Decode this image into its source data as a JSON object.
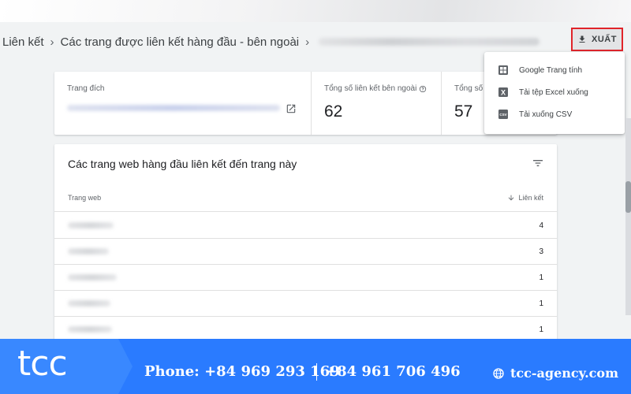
{
  "breadcrumb": {
    "items": [
      "Liên kết",
      "Các trang được liên kết hàng đầu - bên ngoài"
    ]
  },
  "toolbar": {
    "export_label": "XUẤT"
  },
  "export_menu": {
    "items": [
      {
        "label": "Google Trang tính",
        "icon": "sheets-icon"
      },
      {
        "label": "Tải tệp Excel xuống",
        "icon": "excel-icon"
      },
      {
        "label": "Tải xuống CSV",
        "icon": "csv-icon"
      }
    ]
  },
  "summary": {
    "target_label": "Trang đích",
    "external_links_label": "Tổng số liên kết bên ngoài",
    "external_links_value": "62",
    "sites_label": "Tổng số",
    "sites_value": "57"
  },
  "table": {
    "title": "Các trang web hàng đầu liên kết đến trang này",
    "col_site": "Trang web",
    "col_links": "Liên kết",
    "rows": [
      {
        "links": "4"
      },
      {
        "links": "3"
      },
      {
        "links": "1"
      },
      {
        "links": "1"
      },
      {
        "links": "1"
      }
    ]
  },
  "footer": {
    "logo": "tcc",
    "phone1": "Phone: +84 969 293 169",
    "phone2": "+84 961 706 496",
    "website": "tcc-agency.com"
  },
  "colors": {
    "accent_blue": "#2a7bff",
    "highlight_red": "#e0242a",
    "sheets_green": "#5f6368"
  }
}
